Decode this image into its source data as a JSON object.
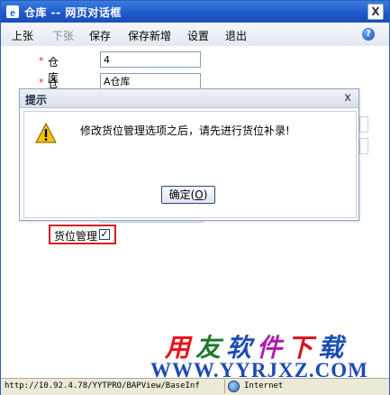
{
  "window": {
    "title": "仓库 -- 网页对话框",
    "close_glyph": "X"
  },
  "toolbar": {
    "items": [
      {
        "label": "上张",
        "enabled": true
      },
      {
        "label": "下张",
        "enabled": false
      },
      {
        "label": "保存",
        "enabled": true
      },
      {
        "label": "保存新增",
        "enabled": true
      },
      {
        "label": "设置",
        "enabled": true
      },
      {
        "label": "退出",
        "enabled": true
      }
    ],
    "help_glyph": "?"
  },
  "form": {
    "required_mark": "*",
    "code_label": "仓库编码",
    "code_value": "4",
    "name_label": "仓库名称",
    "name_value": "A仓库",
    "bin_label": "货位管理",
    "bin_checked": true,
    "check_glyph": "✓"
  },
  "dialog": {
    "title": "提示",
    "close_glyph": "x",
    "message": "修改货位管理选项之后，请先进行货位补录!",
    "ok_label": "确定",
    "ok_mnemonic": "O"
  },
  "watermark": {
    "line1": [
      "用",
      "友",
      "软",
      "件",
      "下",
      "载"
    ],
    "line2": "WWW.YYRJXZ.COM"
  },
  "statusbar": {
    "url": "http://10.92.4.78/YYTPRO/BAPView/BaseInf",
    "zone": "Internet"
  },
  "colors": {
    "title_bar": "#1c56c7",
    "required": "#e23333",
    "highlight_border": "#d21f26"
  }
}
